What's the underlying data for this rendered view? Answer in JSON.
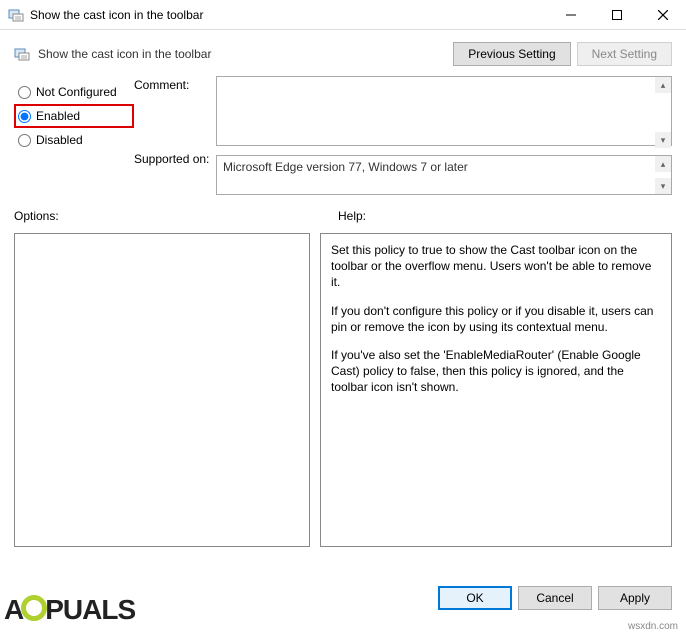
{
  "window": {
    "title": "Show the cast icon in the toolbar"
  },
  "header": {
    "title": "Show the cast icon in the toolbar",
    "previous_setting": "Previous Setting",
    "next_setting": "Next Setting"
  },
  "radios": {
    "not_configured": "Not Configured",
    "enabled": "Enabled",
    "disabled": "Disabled",
    "selected": "enabled"
  },
  "labels": {
    "comment": "Comment:",
    "supported_on": "Supported on:",
    "options": "Options:",
    "help": "Help:"
  },
  "fields": {
    "comment": "",
    "supported_on": "Microsoft Edge version 77, Windows 7 or later"
  },
  "help": {
    "p1": "Set this policy to true to show the Cast toolbar icon on the toolbar or the overflow menu. Users won't be able to remove it.",
    "p2": "If you don't configure this policy or if you disable it, users can pin or remove the icon by using its contextual menu.",
    "p3": "If you've also set the 'EnableMediaRouter' (Enable Google Cast) policy to false, then this policy is ignored, and the toolbar icon isn't shown."
  },
  "buttons": {
    "ok": "OK",
    "cancel": "Cancel",
    "apply": "Apply"
  },
  "watermark": {
    "site": "wsxdn.com",
    "logo_prefix": "A",
    "logo_suffix": "PUALS"
  }
}
